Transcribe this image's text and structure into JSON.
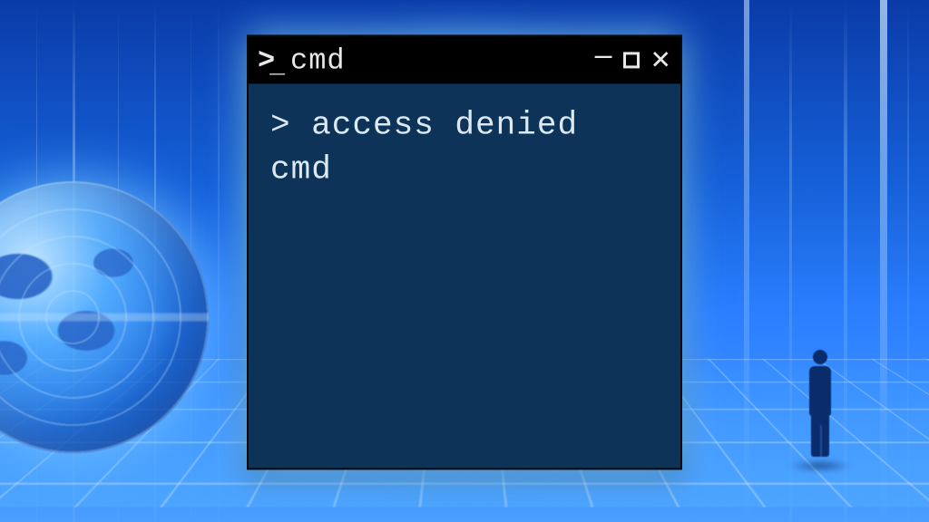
{
  "window": {
    "title": "cmd",
    "prompt_icon_gt": ">",
    "prompt_icon_underscore": "_",
    "controls": {
      "minimize": "–",
      "close": "✕"
    }
  },
  "terminal": {
    "line1": "> access denied cmd"
  },
  "colors": {
    "terminal_bg": "#0d3358",
    "titlebar_bg": "#000000",
    "text": "#dce8f2",
    "glow": "#78c8ff"
  }
}
